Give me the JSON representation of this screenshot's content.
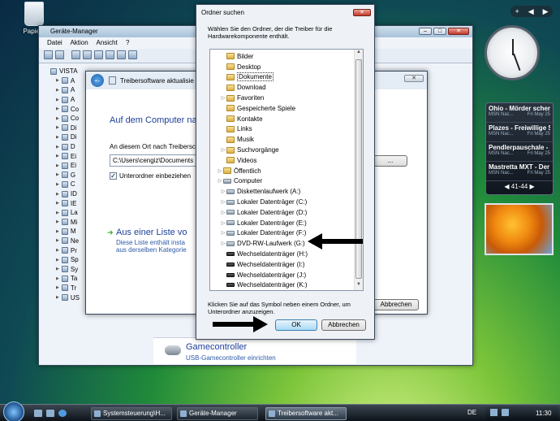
{
  "desktop": {
    "recycle_bin_label": "Papierk"
  },
  "device_manager": {
    "title": "Geräte-Manager",
    "menu": [
      "Datei",
      "Aktion",
      "Ansicht",
      "?"
    ],
    "tree_root": "VISTA",
    "tree_items": [
      "A",
      "A",
      "A",
      "Co",
      "Co",
      "Di",
      "Di",
      "D",
      "Ei",
      "Ei",
      "G",
      "C",
      "ID",
      "IE",
      "La",
      "Mi",
      "M",
      "Ne",
      "Pr",
      "Sp",
      "Sy",
      "Ta",
      "Tr",
      "US"
    ]
  },
  "driver_wizard": {
    "title": "Treibersoftware aktualisie",
    "heading": "Auf dem Computer nac",
    "search_label": "An diesem Ort nach Treibersc",
    "path_value": "C:\\Users\\cengiz\\Documents",
    "browse_button": "...",
    "subfolder_label": "Unterordner einbeziehen",
    "subfolder_checked": true,
    "link_title": "Aus einer Liste vo",
    "link_desc_1": "Diese Liste enthält insta",
    "link_desc_2": "aus derselben Kategorie",
    "cancel_button": "Abbrechen"
  },
  "gamecontroller": {
    "title": "Gamecontroller",
    "subtitle": "USB-Gamecontroller einrichten"
  },
  "folder_dialog": {
    "title": "Ordner suchen",
    "close": "✕",
    "instruction": "Wählen Sie den Ordner, der die Treiber für die Hardwarekomponente enthält.",
    "hint": "Klicken Sie auf das Symbol neben einem Ordner, um Unterordner anzuzeigen.",
    "ok_button": "OK",
    "cancel_button": "Abbrechen",
    "items": [
      {
        "label": "Bilder",
        "icon": "folder-icon",
        "expander": false
      },
      {
        "label": "Desktop",
        "icon": "folder-icon",
        "expander": false
      },
      {
        "label": "Dokumente",
        "icon": "folder-icon",
        "expander": false
      },
      {
        "label": "Download",
        "icon": "folder-icon",
        "expander": false
      },
      {
        "label": "Favoriten",
        "icon": "folder-icon",
        "expander": true
      },
      {
        "label": "Gespeicherte Spiele",
        "icon": "folder-icon",
        "expander": false
      },
      {
        "label": "Kontakte",
        "icon": "folder-icon",
        "expander": false
      },
      {
        "label": "Links",
        "icon": "folder-icon",
        "expander": false
      },
      {
        "label": "Musik",
        "icon": "folder-icon",
        "expander": false
      },
      {
        "label": "Suchvorgänge",
        "icon": "folder-icon",
        "expander": true
      },
      {
        "label": "Videos",
        "icon": "folder-icon",
        "expander": false
      },
      {
        "label": "Öffentlich",
        "icon": "folder-icon",
        "expander": true
      },
      {
        "label": "Computer",
        "icon": "computer-icon",
        "expander": true
      },
      {
        "label": "Diskettenlaufwerk (A:)",
        "icon": "floppy-icon",
        "expander": true
      },
      {
        "label": "Lokaler Datenträger (C:)",
        "icon": "drive-icon",
        "expander": true
      },
      {
        "label": "Lokaler Datenträger (D:)",
        "icon": "drive-icon",
        "expander": true
      },
      {
        "label": "Lokaler Datenträger (E:)",
        "icon": "drive-icon",
        "expander": true
      },
      {
        "label": "Lokaler Datenträger (F:)",
        "icon": "drive-icon",
        "expander": true
      },
      {
        "label": "DVD-RW-Laufwerk (G:)",
        "icon": "dvd-drive-icon",
        "expander": true
      },
      {
        "label": "Wechseldatenträger (H:)",
        "icon": "removable-drive-icon",
        "expander": false
      },
      {
        "label": "Wechseldatenträger (I:)",
        "icon": "removable-drive-icon",
        "expander": false
      },
      {
        "label": "Wechseldatenträger (J:)",
        "icon": "removable-drive-icon",
        "expander": false
      },
      {
        "label": "Wechseldatenträger (K:)",
        "icon": "removable-drive-icon",
        "expander": false
      }
    ],
    "selected_item": "Dokumente"
  },
  "sidebar": {
    "add_button": "+",
    "feed": [
      {
        "title": "Ohio - Mörder scherz...",
        "source": "MSN Nac...",
        "date": "Fri May 25"
      },
      {
        "title": "Plazes - Freiwillige S...",
        "source": "MSN Nac...",
        "date": "Fri May 25"
      },
      {
        "title": "Pendlerpauschale - F...",
        "source": "MSN Nac...",
        "date": "Fri May 25"
      },
      {
        "title": "Mastretta MXT - Der ...",
        "source": "MSN Nac...",
        "date": "Fri May 25"
      }
    ],
    "feed_pager": "41-44"
  },
  "taskbar": {
    "tasks": [
      "Systemsteuerung\\H...",
      "Geräte-Manager",
      "Treibersoftware akt..."
    ],
    "language": "DE",
    "clock": "11:30"
  }
}
